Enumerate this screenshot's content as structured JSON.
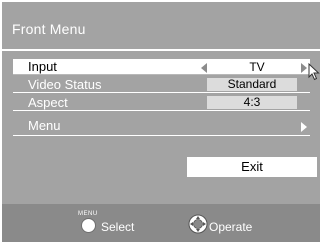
{
  "menu": {
    "title": "Front Menu",
    "rows": [
      {
        "label": "Input",
        "value": "TV"
      },
      {
        "label": "Video Status",
        "value": "Standard"
      },
      {
        "label": "Aspect",
        "value": "4:3"
      },
      {
        "label": "Menu"
      }
    ],
    "exit_label": "Exit"
  },
  "footer": {
    "menu_caption": "MENU",
    "select_label": "Select",
    "operate_label": "Operate"
  },
  "icons": {
    "left_arrow": "triangle-left",
    "right_arrow": "triangle-right",
    "pointer": "mouse-pointer",
    "select_button": "circle-button",
    "operate_button": "directional-pad"
  },
  "colors": {
    "panel": "#a3a3a3",
    "footer": "#8a8a8a",
    "highlight": "#ffffff",
    "value_box": "#dcdcdc"
  }
}
